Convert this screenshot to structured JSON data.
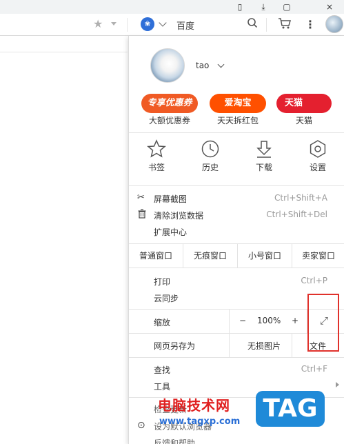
{
  "toolbar": {
    "star_icon": "star-icon",
    "search_engine_icon_glyph": "❀",
    "search_engine_name": "百度",
    "icons": [
      "search-icon",
      "cart-icon",
      "more-icon",
      "avatar"
    ]
  },
  "window_controls": [
    "bar-icon",
    "download-icon",
    "pin-icon"
  ],
  "user": {
    "name": "tao"
  },
  "promos": [
    {
      "badge": "专享优惠券",
      "label": "大额优惠券",
      "color": "#f05a24"
    },
    {
      "badge": "爱淘宝",
      "label": "天天拆红包",
      "color": "#ff5000"
    },
    {
      "badge": "天猫",
      "label": "天猫",
      "color": "#e4202f"
    }
  ],
  "quick_actions": [
    {
      "label": "书签",
      "icon": "bookmark-star-icon"
    },
    {
      "label": "历史",
      "icon": "history-clock-icon"
    },
    {
      "label": "下载",
      "icon": "download-icon"
    },
    {
      "label": "设置",
      "icon": "settings-gear-icon"
    }
  ],
  "tools_group": [
    {
      "label": "屏幕截图",
      "shortcut": "Ctrl+Shift+A",
      "icon": "scissors-icon"
    },
    {
      "label": "清除浏览数据",
      "shortcut": "Ctrl+Shift+Del",
      "icon": "trash-icon"
    },
    {
      "label": "扩展中心",
      "shortcut": "",
      "icon": ""
    }
  ],
  "window_modes": [
    "普通窗口",
    "无痕窗口",
    "小号窗口",
    "卖家窗口"
  ],
  "print_group": [
    {
      "label": "打印",
      "shortcut": "Ctrl+P"
    },
    {
      "label": "云同步",
      "shortcut": ""
    }
  ],
  "zoom": {
    "label": "缩放",
    "minus": "−",
    "value": "100%",
    "plus": "+",
    "fullscreen_glyph": "⤢"
  },
  "save_row": {
    "label": "网页另存为",
    "option_no_images": "无损图片",
    "option_file": "文件"
  },
  "find_group": [
    {
      "label": "查找",
      "shortcut": "Ctrl+F"
    },
    {
      "label": "工具",
      "shortcut": ""
    }
  ],
  "bottom_items": [
    {
      "label": "检查更新"
    },
    {
      "label": "设为默认浏览器"
    },
    {
      "label": "反馈和帮助"
    }
  ],
  "watermark": {
    "title": "电脑技术网",
    "url": "www.tagxp.com",
    "badge": "TAG",
    "badge_color": "#1f8ad8"
  },
  "colors": {
    "highlight": "#e0312b",
    "shortcut_text": "#999999"
  }
}
